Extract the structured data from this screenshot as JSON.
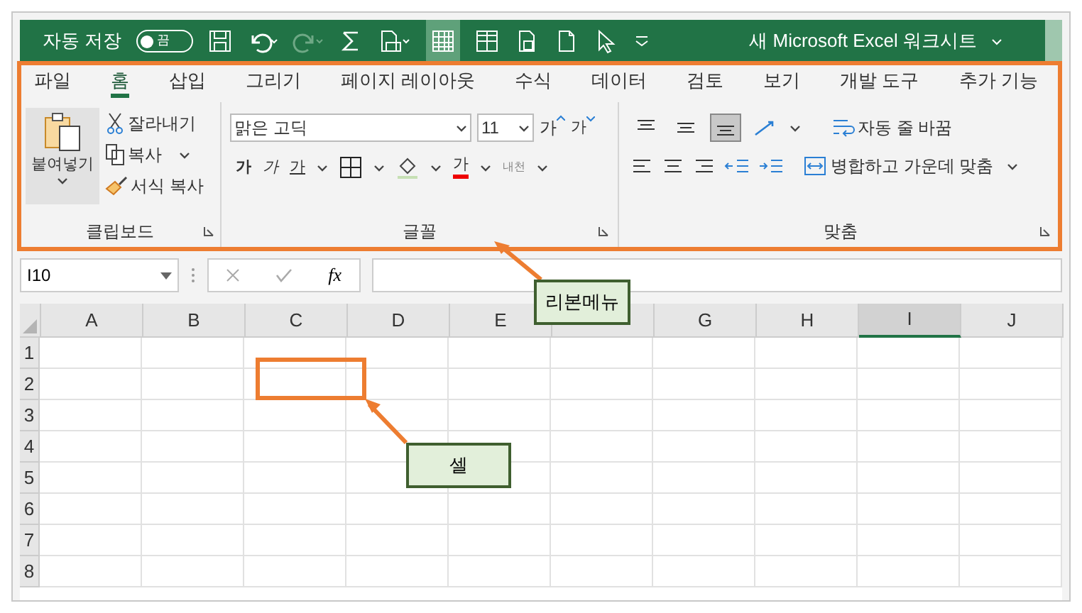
{
  "title_bar": {
    "autosave_label": "자동 저장",
    "autosave_toggle": {
      "label": "끔",
      "on": false
    },
    "title": "새 Microsoft Excel 워크시트"
  },
  "tabs": [
    {
      "label": "파일",
      "selected": false
    },
    {
      "label": "홈",
      "selected": true
    },
    {
      "label": "삽입",
      "selected": false
    },
    {
      "label": "그리기",
      "selected": false
    },
    {
      "label": "페이지 레이아웃",
      "selected": false
    },
    {
      "label": "수식",
      "selected": false
    },
    {
      "label": "데이터",
      "selected": false
    },
    {
      "label": "검토",
      "selected": false
    },
    {
      "label": "보기",
      "selected": false
    },
    {
      "label": "개발 도구",
      "selected": false
    },
    {
      "label": "추가 기능",
      "selected": false
    }
  ],
  "clipboard": {
    "paste": "붙여넣기",
    "cut": "잘라내기",
    "copy": "복사",
    "format_painter": "서식 복사",
    "group_label": "클립보드"
  },
  "font": {
    "font_name": "맑은 고딕",
    "font_size": "11",
    "grow": "가",
    "shrink": "가",
    "bold": "가",
    "italic": "가",
    "underline": "가",
    "font_color": "가",
    "phonetic": "내천",
    "group_label": "글꼴"
  },
  "alignment": {
    "vertical": [
      {
        "selected": false
      },
      {
        "selected": false
      },
      {
        "selected": true
      }
    ],
    "wrap_text": "자동 줄 바꿈",
    "merge_center": "병합하고 가운데 맞춤",
    "group_label": "맞춤"
  },
  "name_box": "I10",
  "function_label": "fx",
  "columns": [
    {
      "label": "A",
      "selected": false
    },
    {
      "label": "B",
      "selected": false
    },
    {
      "label": "C",
      "selected": false
    },
    {
      "label": "D",
      "selected": false
    },
    {
      "label": "E",
      "selected": false
    },
    {
      "selected": false
    },
    {
      "label": "G",
      "selected": false
    },
    {
      "label": "H",
      "selected": false
    },
    {
      "label": "I",
      "selected": true
    },
    {
      "label": "J",
      "selected": false
    }
  ],
  "rows": [
    "1",
    "2",
    "3",
    "4",
    "5",
    "6",
    "7",
    "8"
  ],
  "callouts": [
    {
      "label": "리본메뉴"
    },
    {
      "label": "셀"
    }
  ]
}
